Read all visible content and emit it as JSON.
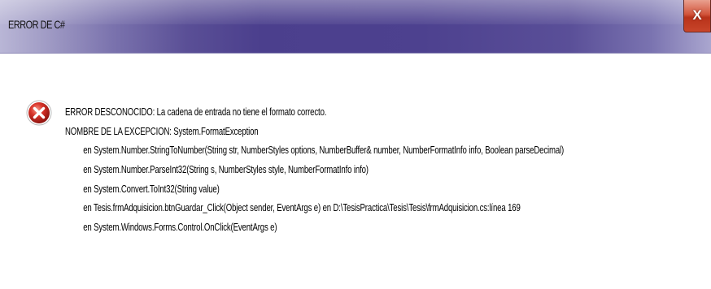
{
  "window": {
    "title": "ERROR DE C#",
    "close_glyph": "X"
  },
  "icon": {
    "name": "error-icon",
    "color": "#d9342a"
  },
  "message": {
    "lines": [
      "ERROR DESCONOCIDO: La cadena de entrada no tiene el formato correcto.",
      "NOMBRE DE LA EXCEPCION: System.FormatException",
      "en System.Number.StringToNumber(String str, NumberStyles options, NumberBuffer& number, NumberFormatInfo info, Boolean parseDecimal)",
      "en System.Number.ParseInt32(String s, NumberStyles style, NumberFormatInfo info)",
      "en System.Convert.ToInt32(String value)",
      "en Tesis.frmAdquisicion.btnGuardar_Click(Object sender, EventArgs e) en D:\\TesisPractica\\Tesis\\Tesis\\frmAdquisicion.cs:línea 169",
      "en System.Windows.Forms.Control.OnClick(EventArgs e)"
    ]
  }
}
